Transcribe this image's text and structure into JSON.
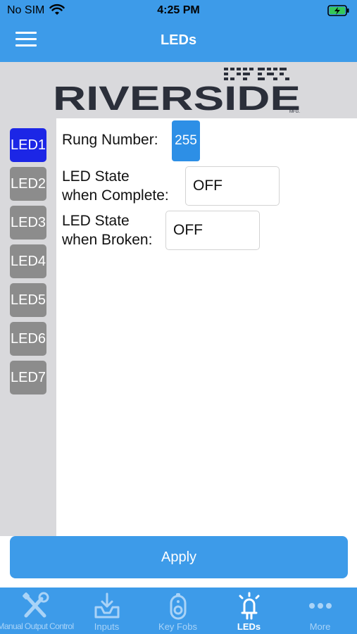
{
  "status": {
    "carrier": "No SIM",
    "time": "4:25 PM"
  },
  "nav": {
    "title": "LEDs",
    "menu_icon": "hamburger-menu-icon"
  },
  "logo": {
    "text": "RIVERSIDE",
    "suffix": "MFG."
  },
  "sidebar": {
    "items": [
      {
        "label": "LED1",
        "selected": true
      },
      {
        "label": "LED2",
        "selected": false
      },
      {
        "label": "LED3",
        "selected": false
      },
      {
        "label": "LED4",
        "selected": false
      },
      {
        "label": "LED5",
        "selected": false
      },
      {
        "label": "LED6",
        "selected": false
      },
      {
        "label": "LED7",
        "selected": false
      }
    ]
  },
  "form": {
    "rung_label": "Rung Number:",
    "rung_value": "255",
    "complete_label_1": "LED State",
    "complete_label_2": "when Complete:",
    "complete_value": "OFF",
    "broken_label_1": "LED State",
    "broken_label_2": "when Broken:",
    "broken_value": "OFF"
  },
  "apply": {
    "label": "Apply"
  },
  "tabs": [
    {
      "label": "Manual Output Control",
      "icon": "tools-icon",
      "active": false
    },
    {
      "label": "Inputs",
      "icon": "inputs-icon",
      "active": false
    },
    {
      "label": "Key Fobs",
      "icon": "key-fob-icon",
      "active": false
    },
    {
      "label": "LEDs",
      "icon": "led-icon",
      "active": true
    },
    {
      "label": "More",
      "icon": "more-icon",
      "active": false
    }
  ],
  "colors": {
    "accent": "#3d9be9",
    "selected_led": "#1c26e6",
    "inactive_led": "#8c8c8c",
    "panel_gray": "#d9d9dc"
  }
}
